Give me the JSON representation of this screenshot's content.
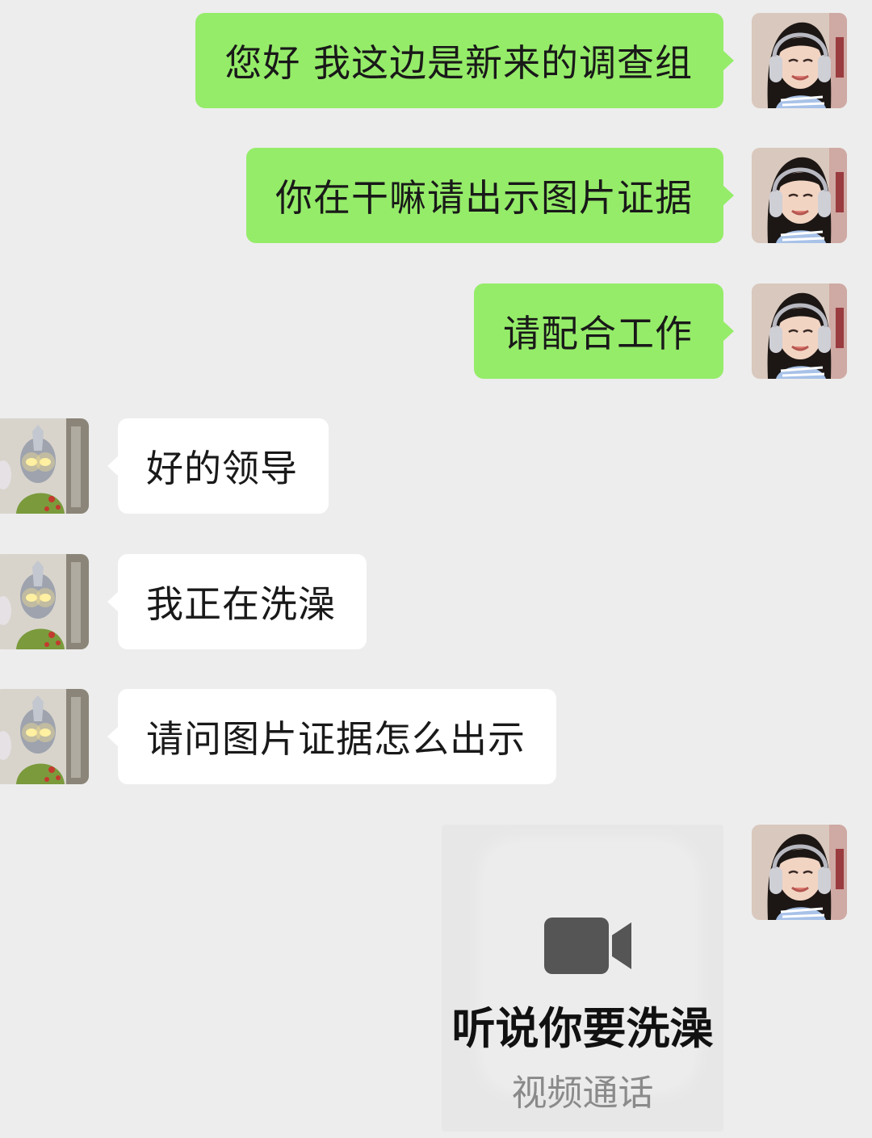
{
  "chat": {
    "messages": [
      {
        "side": "me",
        "text": "您好 我这边是新来的调查组"
      },
      {
        "side": "me",
        "text": "你在干嘛请出示图片证据"
      },
      {
        "side": "me",
        "text": "请配合工作"
      },
      {
        "side": "them",
        "text": "好的领导"
      },
      {
        "side": "them",
        "text": "我正在洗澡"
      },
      {
        "side": "them",
        "text": "请问图片证据怎么出示"
      }
    ],
    "video_card": {
      "title": "听说你要洗澡",
      "subtitle": "视频通话",
      "icon": "video-camera-icon"
    }
  },
  "colors": {
    "background": "#ededed",
    "my_bubble": "#95ec69",
    "their_bubble": "#ffffff"
  },
  "avatars": {
    "me": "girl-with-headphones-avatar",
    "them": "ultraman-figure-avatar"
  }
}
